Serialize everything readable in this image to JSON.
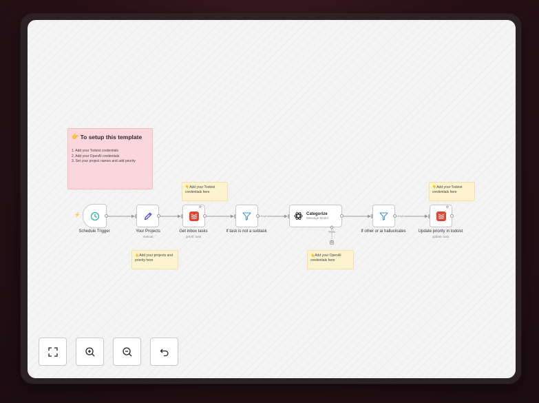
{
  "setup_note": {
    "emoji": "👉",
    "title": "To setup this template",
    "steps": [
      "1. Add your Todoist credentials",
      "2. Add your OpenAI credentials",
      "3. Set your project names and add priority"
    ]
  },
  "notes": {
    "todoist_credentials_1": "👇Add your Todoist credentials here",
    "todoist_credentials_2": "👇Add your Todoist credentials here",
    "projects": "👆Add your projects and priority here",
    "openai": "👆Add your OpenAI credentials here"
  },
  "nodes": {
    "schedule_trigger": {
      "label": "Schedule Trigger"
    },
    "your_projects": {
      "label": "Your Projects",
      "sub": "manual"
    },
    "get_inbox_tasks": {
      "label": "Get inbox tasks",
      "sub": "getAll: task"
    },
    "if_not_subtask": {
      "label": "If task is not a subtask"
    },
    "categorize": {
      "title": "Categorize",
      "sub": "Message Model",
      "tools_label": "Tools"
    },
    "if_hallucinates": {
      "label": "If other or ai hallucinates"
    },
    "update_priority": {
      "label": "Update priority in todoist",
      "sub": "update: task"
    }
  },
  "edge_labels": {
    "filter1_kept": "Kept",
    "filter2_kept": "Kept"
  },
  "controls": {
    "fit_view": "fit-view",
    "zoom_in": "zoom-in",
    "zoom_out": "zoom-out",
    "reset": "reset-zoom"
  },
  "colors": {
    "todoist": "#e44332",
    "trigger_accent": "#2fb59b",
    "edit_accent": "#3b3fd0",
    "filter_accent": "#3d8fd9",
    "sticky_pink": "#fcd6dd",
    "sticky_yellow": "#fdf3cf"
  }
}
